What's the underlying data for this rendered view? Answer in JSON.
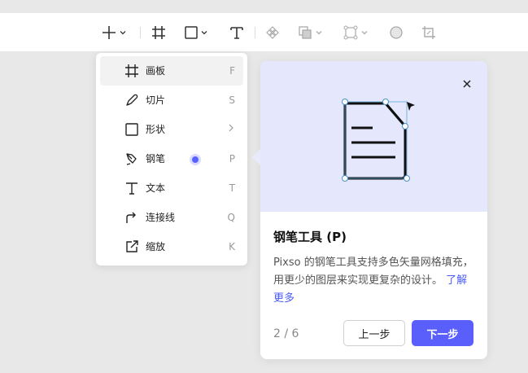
{
  "toolbar": {
    "tools": [
      {
        "name": "add",
        "icon": "plus-icon"
      },
      {
        "name": "frame",
        "icon": "frame-icon"
      },
      {
        "name": "shape",
        "icon": "rectangle-icon"
      },
      {
        "name": "text",
        "icon": "text-icon"
      },
      {
        "name": "component",
        "icon": "component-icon"
      },
      {
        "name": "boolean",
        "icon": "boolean-icon"
      },
      {
        "name": "selection",
        "icon": "selection-icon"
      },
      {
        "name": "ellipse",
        "icon": "circle-icon"
      },
      {
        "name": "crop",
        "icon": "crop-icon"
      }
    ]
  },
  "menu": {
    "items": [
      {
        "label": "画板",
        "key": "F",
        "icon": "frame-icon",
        "active": true
      },
      {
        "label": "切片",
        "key": "S",
        "icon": "slice-icon"
      },
      {
        "label": "形状",
        "key": ">",
        "icon": "rectangle-icon"
      },
      {
        "label": "钢笔",
        "key": "P",
        "icon": "pen-icon",
        "badge": true
      },
      {
        "label": "文本",
        "key": "T",
        "icon": "text-icon"
      },
      {
        "label": "连接线",
        "key": "Q",
        "icon": "connector-icon"
      },
      {
        "label": "缩放",
        "key": "K",
        "icon": "scale-icon"
      }
    ]
  },
  "popover": {
    "title": "钢笔工具 (P)",
    "body": "Pixso 的钢笔工具支持多色矢量网格填充，用更少的图层来实现更复杂的设计。",
    "link": "了解更多",
    "page": "2 / 6",
    "prev_label": "上一步",
    "next_label": "下一步"
  },
  "colors": {
    "accent": "#5a5ffb",
    "hero_bg": "#e5e8fd",
    "link": "#4a5bf4"
  }
}
